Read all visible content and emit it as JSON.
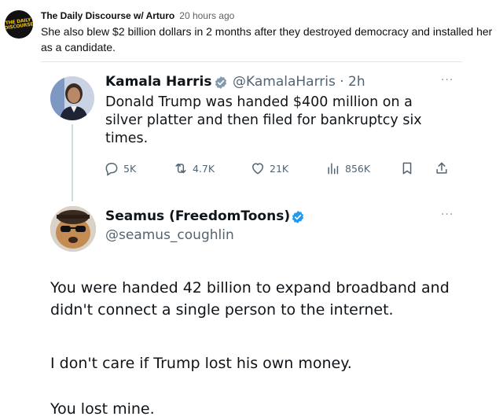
{
  "post": {
    "channel_logo_text": "THE DAILY DISCOURSE",
    "author": "The Daily Discourse w/ Arturo",
    "time": "20 hours ago",
    "text": "She also blew $2 billion dollars in 2 months after they destroyed democracy and installed her as a candidate."
  },
  "tweet1": {
    "name": "Kamala Harris",
    "handle_time": "@KamalaHarris · 2h",
    "text": "Donald Trump was handed $400 million on a silver platter and then filed for bankruptcy six times.",
    "more": "···",
    "actions": {
      "reply": "5K",
      "retweet": "4.7K",
      "like": "21K",
      "views": "856K"
    }
  },
  "tweet2": {
    "name": "Seamus (FreedomToons)",
    "handle": "@seamus_coughlin",
    "more": "···",
    "paragraphs": [
      "You were handed 42 billion to expand broadband and didn't connect a single person to the internet.",
      "I don't care if Trump lost his own money.",
      "You lost mine."
    ]
  },
  "colors": {
    "verified": "#829aab",
    "secondary_text": "#536471",
    "logo_yellow": "#f2c200"
  }
}
